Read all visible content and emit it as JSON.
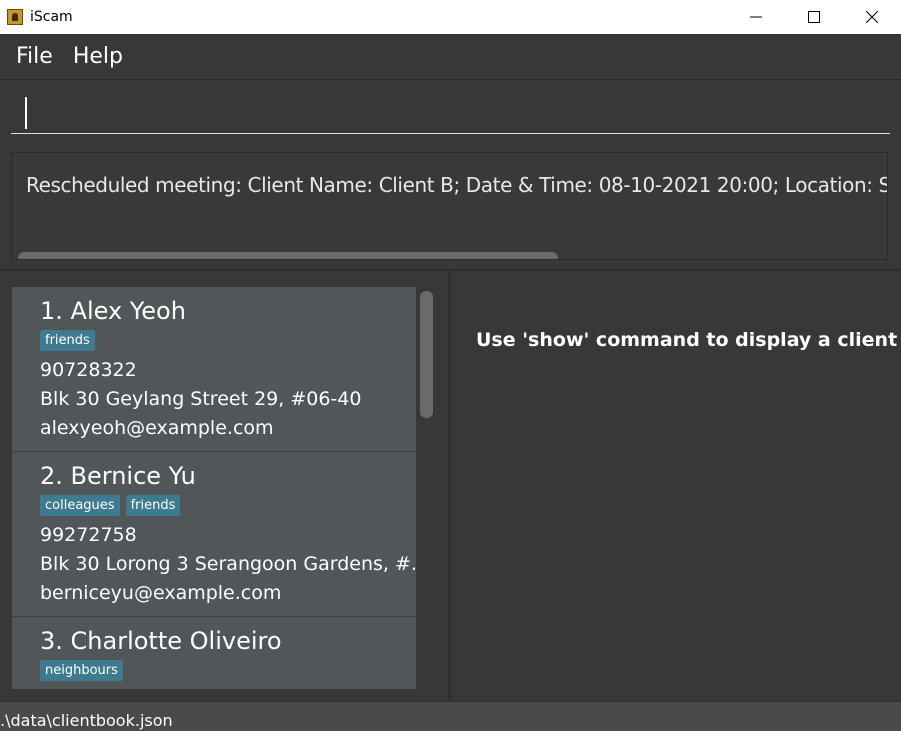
{
  "window": {
    "title": "iScam",
    "icon": "app-icon"
  },
  "menu": {
    "items": [
      {
        "label": "File"
      },
      {
        "label": "Help"
      }
    ]
  },
  "command": {
    "value": ""
  },
  "result": {
    "text": "Rescheduled meeting: Client Name: Client B; Date & Time: 08-10-2021 20:00; Location: Starbucks"
  },
  "clients": [
    {
      "title": "1.  Alex Yeoh",
      "tags": [
        "friends"
      ],
      "phone": "90728322",
      "address": "Blk 30 Geylang Street 29, #06-40",
      "email": "alexyeoh@example.com"
    },
    {
      "title": "2.  Bernice Yu",
      "tags": [
        "colleagues",
        "friends"
      ],
      "phone": "99272758",
      "address": "Blk 30 Lorong 3 Serangoon Gardens, #...",
      "email": "berniceyu@example.com"
    },
    {
      "title": "3.  Charlotte Oliveiro",
      "tags": [
        "neighbours"
      ],
      "phone": "",
      "address": "",
      "email": ""
    }
  ],
  "detail": {
    "placeholder": "Use 'show' command to display a client h..."
  },
  "status": {
    "path": ".\\data\\clientbook.json"
  },
  "colors": {
    "tag": "#3e7b91",
    "card": "#515659",
    "background": "#383838"
  }
}
